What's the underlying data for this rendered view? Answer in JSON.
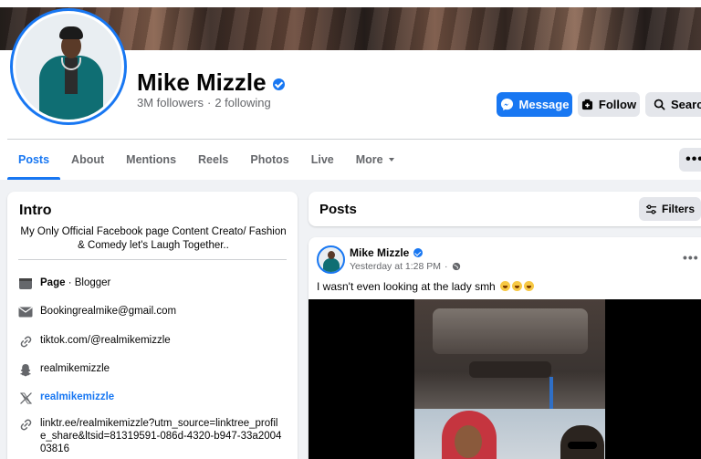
{
  "profile": {
    "name": "Mike Mizzle",
    "followers": "3M followers",
    "separator": "·",
    "following": "2 following"
  },
  "actions": {
    "message": "Message",
    "follow": "Follow",
    "search": "Search",
    "more_dots": "•••"
  },
  "tabs": [
    {
      "label": "Posts",
      "active": true
    },
    {
      "label": "About"
    },
    {
      "label": "Mentions"
    },
    {
      "label": "Reels"
    },
    {
      "label": "Photos"
    },
    {
      "label": "Live"
    },
    {
      "label": "More"
    }
  ],
  "intro": {
    "title": "Intro",
    "bio": "My Only Official Facebook page Content Creato/ Fashion & Comedy let's Laugh Together..",
    "items": [
      {
        "icon": "page-icon",
        "strong": "Page",
        "text": " · Blogger"
      },
      {
        "icon": "mail-icon",
        "text": "Bookingrealmike@gmail.com"
      },
      {
        "icon": "link-icon",
        "text": "tiktok.com/@realmikemizzle"
      },
      {
        "icon": "snapchat-icon",
        "text": "realmikemizzle"
      },
      {
        "icon": "x-icon",
        "text": "realmikemizzle",
        "link": true
      },
      {
        "icon": "link-icon",
        "text": "linktr.ee/realmikemizzle?utm_source=linktree_profile_share&ltsid=81319591-086d-4320-b947-33a200403816"
      }
    ]
  },
  "posts": {
    "title": "Posts",
    "filters": "Filters",
    "post": {
      "author": "Mike Mizzle",
      "time": "Yesterday at 1:28 PM",
      "time_sep": "·",
      "text": "I wasn't even looking at the lady smh",
      "menu": "•••"
    }
  },
  "colors": {
    "accent": "#1877f2",
    "background": "#f0f2f5",
    "button_gray": "#e4e6eb",
    "secondary_text": "#65676b"
  }
}
